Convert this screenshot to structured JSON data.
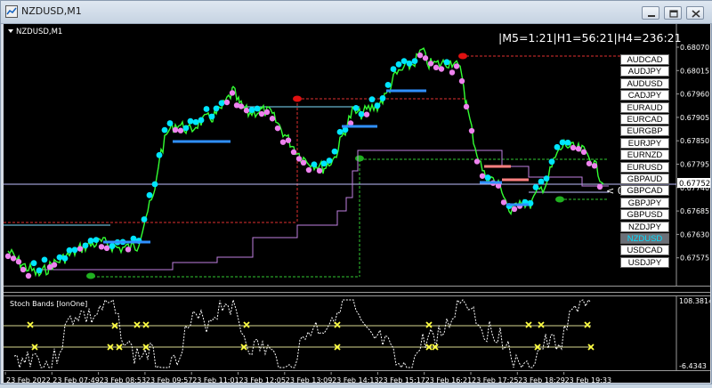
{
  "window": {
    "title": "NZDUSD,M1",
    "controls": [
      "minimize",
      "restore",
      "close"
    ]
  },
  "chart": {
    "symbol_label": "NZDUSD,M1",
    "timer_text": "|M5=1:21|H1=56:21|H4=236:21",
    "countdown_text": "< 0:21",
    "current_price": "0.67752",
    "price_axis": [
      "0.68070",
      "0.68015",
      "0.67960",
      "0.67905",
      "0.67850",
      "0.67795",
      "0.67740",
      "0.67685",
      "0.67630",
      "0.67575"
    ],
    "symbols": [
      "AUDCAD",
      "AUDJPY",
      "AUDUSD",
      "CADJPY",
      "EURAUD",
      "EURCAD",
      "EURGBP",
      "EURJPY",
      "EURNZD",
      "EURUSD",
      "GBPAUD",
      "GBPCAD",
      "GBPJPY",
      "GBPUSD",
      "NZDJPY",
      "NZDUSD",
      "USDCAD",
      "USDJPY"
    ],
    "active_symbol": "NZDUSD"
  },
  "indicator": {
    "name": "Stoch Bands [IonOne]",
    "axis_top": "108.3814",
    "axis_bottom": "-6.4343"
  },
  "time_axis": [
    "23 Feb 2022",
    "23 Feb 07:49",
    "23 Feb 08:53",
    "23 Feb 09:57",
    "23 Feb 11:01",
    "23 Feb 12:05",
    "23 Feb 13:09",
    "23 Feb 14:13",
    "23 Feb 15:17",
    "23 Feb 16:21",
    "23 Feb 17:25",
    "23 Feb 18:29",
    "23 Feb 19:33"
  ],
  "colors": {
    "price_line": "#32ff32",
    "band_high": "#00e5ff",
    "band_low": "#ee82ee",
    "active_symbol_text": "#00e0ff",
    "level_line": "#d8d890",
    "stoch_marker": "#ffff44"
  }
}
